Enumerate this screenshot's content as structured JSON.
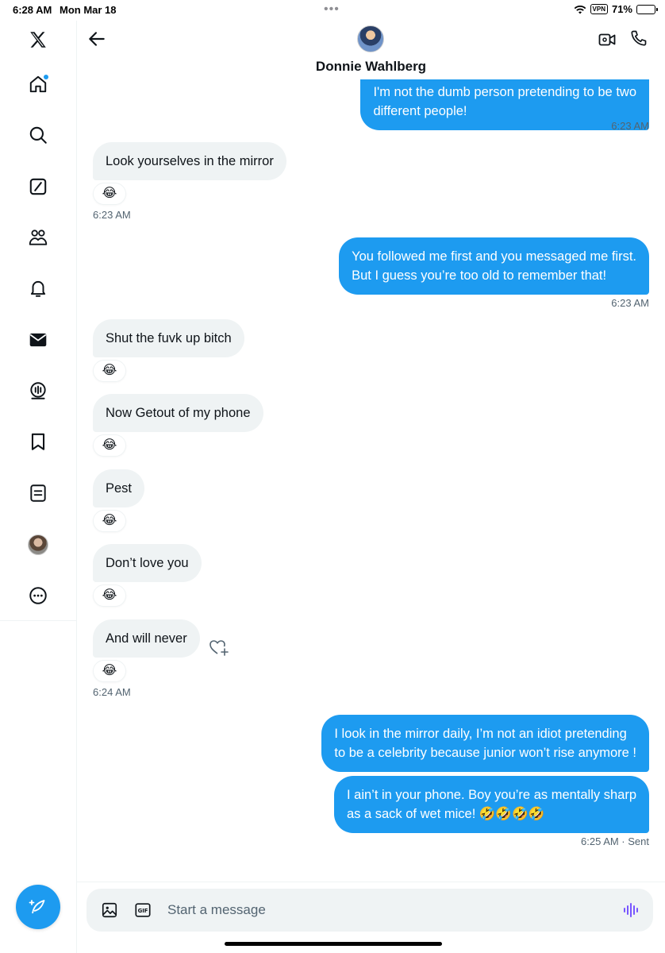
{
  "status_bar": {
    "time": "6:28 AM",
    "date": "Mon Mar 18",
    "vpn": "VPN",
    "battery": "71%",
    "battery_level": 0.71
  },
  "sidebar": {
    "items": [
      {
        "icon": "x-logo-icon"
      },
      {
        "icon": "home-icon",
        "has_notification_dot": true
      },
      {
        "icon": "search-icon"
      },
      {
        "icon": "grok-icon"
      },
      {
        "icon": "communities-icon"
      },
      {
        "icon": "bell-icon"
      },
      {
        "icon": "envelope-icon"
      },
      {
        "icon": "spaces-icon"
      },
      {
        "icon": "bookmark-icon"
      },
      {
        "icon": "lists-icon"
      },
      {
        "icon": "profile-avatar"
      },
      {
        "icon": "more-icon"
      }
    ],
    "compose_icon": "compose-icon"
  },
  "header": {
    "contact_name": "Donnie Wahlberg",
    "back_icon": "back-arrow-icon",
    "video_icon": "video-call-icon",
    "call_icon": "phone-icon"
  },
  "messages": [
    {
      "dir": "out",
      "lines": [
        "I'm not the dumb person pretending to be two",
        "different people!"
      ],
      "time": "6:23 AM"
    },
    {
      "dir": "in",
      "text": "Look yourselves in the mirror",
      "reaction": "😂",
      "time": "6:23 AM"
    },
    {
      "dir": "out",
      "lines": [
        "You followed me first and you messaged me first.",
        "But I guess you’re too old to remember that!"
      ],
      "time": "6:23 AM"
    },
    {
      "dir": "in",
      "text": "Shut the fuvk up bitch",
      "reaction": "😂"
    },
    {
      "dir": "in",
      "text": "Now Getout of my phone",
      "reaction": "😂"
    },
    {
      "dir": "in",
      "text": "Pest",
      "reaction": "😂"
    },
    {
      "dir": "in",
      "text": "Don’t love you",
      "reaction": "😂"
    },
    {
      "dir": "in",
      "text": "And will never",
      "reaction": "😂",
      "time": "6:24 AM"
    },
    {
      "dir": "out",
      "lines": [
        "I look in the mirror daily, I’m not an idiot pretending",
        "to be a celebrity because junior won’t rise anymore !"
      ]
    },
    {
      "dir": "out",
      "lines": [
        "I ain’t in your phone. Boy you’re as mentally sharp",
        "as a sack of wet mice! 🤣🤣🤣🤣"
      ],
      "time": "6:25 AM · Sent"
    }
  ],
  "composer": {
    "placeholder": "Start a message",
    "media_icon": "image-icon",
    "gif_icon": "gif-icon",
    "voice_icon": "voice-wave-icon"
  },
  "colors": {
    "accent": "#1d9bf0",
    "incoming_bubble": "#eff3f4",
    "text_primary": "#0f1419",
    "text_secondary": "#536471",
    "voice_accent": "#7856ff"
  }
}
